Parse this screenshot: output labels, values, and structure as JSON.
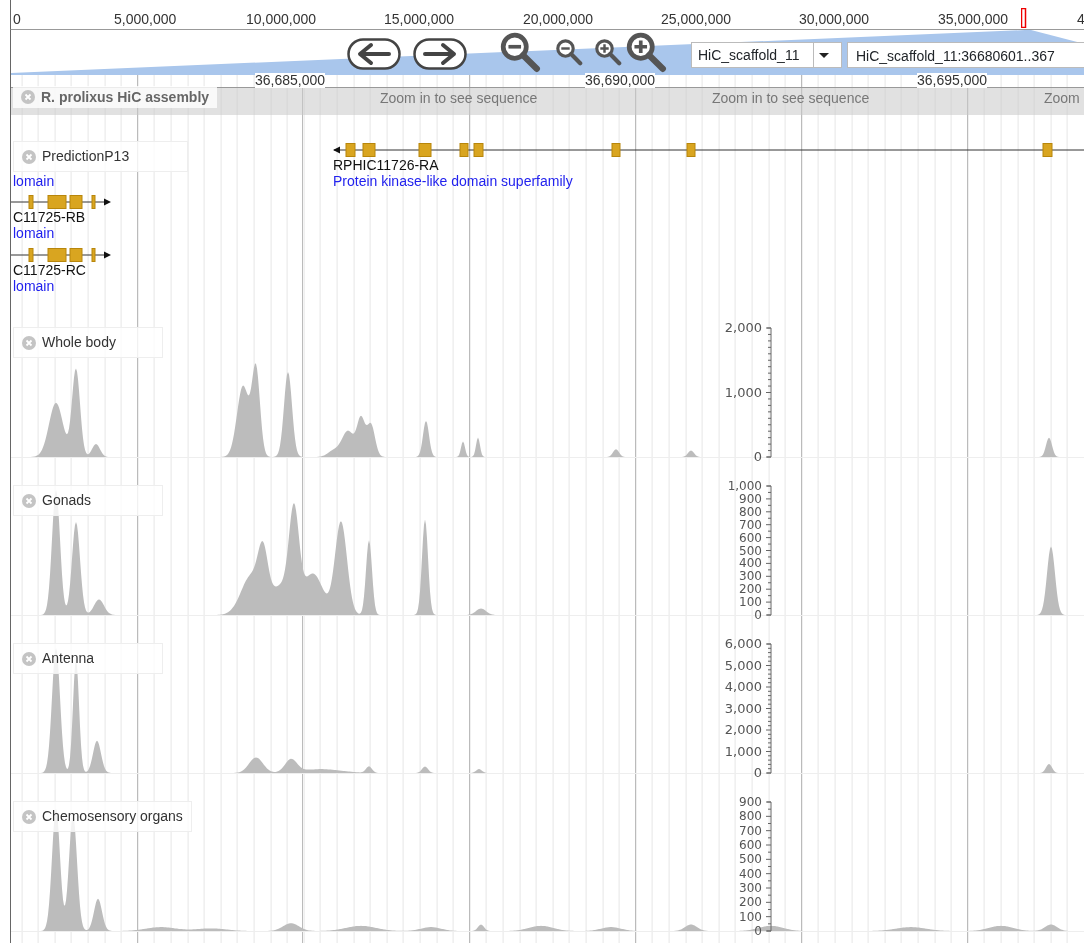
{
  "overview": {
    "labels": [
      "0",
      "5,000,000",
      "10,000,000",
      "15,000,000",
      "20,000,000",
      "25,000,000",
      "30,000,000",
      "35,000,000",
      "4"
    ]
  },
  "reference_select": {
    "value": "HiC_scaffold_11"
  },
  "location_field": {
    "value": "HiC_scaffold_11:36680601..367"
  },
  "ruler": {
    "labels": [
      "36,685,000",
      "36,690,000",
      "36,695,000"
    ]
  },
  "sequence_track": {
    "label": "R. prolixus HiC assembly",
    "messages": [
      "Zoom in to see sequence",
      "Zoom in to see sequence",
      "Zoom"
    ]
  },
  "gene_track": {
    "label": "PredictionP13",
    "features": [
      {
        "note": "lomain"
      },
      {
        "name": "C11725-RB",
        "note": "lomain",
        "reverse": false
      },
      {
        "name": "C11725-RC",
        "note": "lomain",
        "reverse": false
      },
      {
        "name": "RPHIC11726-RA",
        "note": "Protein kinase-like domain superfamily",
        "reverse": true
      }
    ]
  },
  "coverage_tracks": [
    {
      "label": "Whole body",
      "axis_labels": [
        "2,000",
        "1,000",
        "0"
      ]
    },
    {
      "label": "Gonads",
      "axis_labels": [
        "1,000",
        "900",
        "800",
        "700",
        "600",
        "500",
        "400",
        "300",
        "200",
        "100",
        "0"
      ]
    },
    {
      "label": "Antenna",
      "axis_labels": [
        "6,000",
        "5,000",
        "4,000",
        "3,000",
        "2,000",
        "1,000",
        "0"
      ]
    },
    {
      "label": "Chemosensory organs",
      "axis_labels": [
        "900",
        "800",
        "700",
        "600",
        "500",
        "400",
        "300",
        "200",
        "100",
        "0"
      ]
    }
  ]
}
